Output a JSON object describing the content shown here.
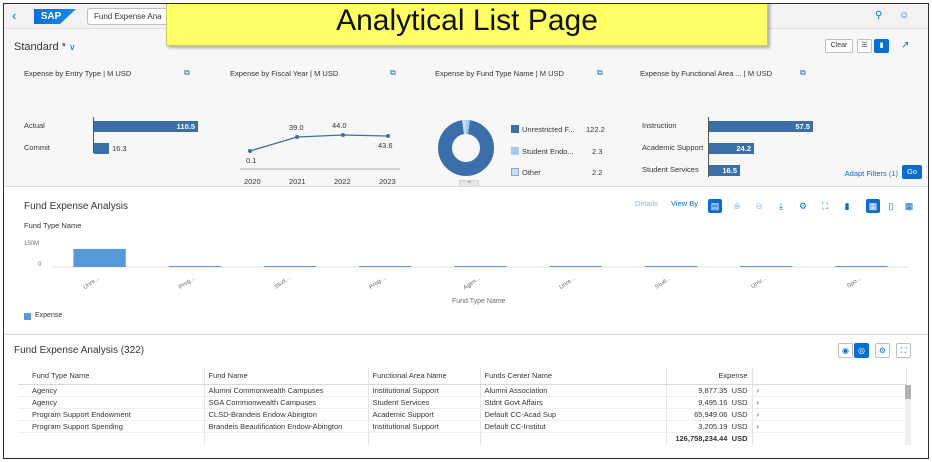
{
  "shell": {
    "app_title": "Fund Expense Ana",
    "logo": "SAP",
    "back_icon": "chevron-left-icon",
    "search_icon": "search-icon",
    "user_icon": "person-icon"
  },
  "banner": {
    "text": "Analytical List Page"
  },
  "header": {
    "variant": "Standard *",
    "clear_label": "Clear",
    "adapt_filters": "Adapt Filters (1)",
    "go_label": "Go",
    "collapse_icon": "chevron-up-icon"
  },
  "mini_charts": {
    "entry_type": {
      "title": "Expense by Entry Type  | M USD",
      "bars": [
        {
          "label": "Actual",
          "value": "110.5"
        },
        {
          "label": "Commit",
          "value": "16.3"
        }
      ]
    },
    "fiscal_year": {
      "title": "Expense by Fiscal Year  | M USD",
      "years": [
        "2020",
        "2021",
        "2022",
        "2023"
      ],
      "values": [
        "0.1",
        "39.0",
        "44.0",
        "43.6"
      ]
    },
    "fund_type": {
      "title": "Expense by Fund Type Name  | M USD",
      "legend": [
        {
          "label": "Unrestricted F...",
          "value": "122.2"
        },
        {
          "label": "Student Endo...",
          "value": "2.3"
        },
        {
          "label": "Other",
          "value": "2.2"
        }
      ]
    },
    "functional_area": {
      "title": "Expense by Functional Area ...  | M USD",
      "bars": [
        {
          "label": "Instruction",
          "value": "57.5"
        },
        {
          "label": "Academic Support",
          "value": "24.2"
        },
        {
          "label": "Student Services",
          "value": "16.5"
        }
      ]
    }
  },
  "chart_section": {
    "title": "Fund Expense Analysis",
    "subtitle": "Fund Type Name",
    "details": "Details",
    "view_by": "View By",
    "x_axis_title": "Fund Type Name",
    "legend": "Expense"
  },
  "chart_data": {
    "type": "bar",
    "categories": [
      "Unre...",
      "Prog...",
      "Stud...",
      "Prog...",
      "Agen...",
      "Unre...",
      "Stud...",
      "Univ...",
      "Spo..."
    ],
    "values": [
      118,
      2,
      2,
      2,
      1.5,
      1.5,
      1.2,
      1,
      1
    ],
    "ytick_labels": [
      "150M",
      "0"
    ],
    "ylim": [
      0,
      150
    ],
    "xlabel": "Fund Type Name",
    "ylabel": "",
    "series": [
      {
        "name": "Expense",
        "values": [
          118,
          2,
          2,
          2,
          1.5,
          1.5,
          1.2,
          1,
          1
        ]
      }
    ],
    "color": "#5899da"
  },
  "table": {
    "title": "Fund Expense Analysis (322)",
    "columns": [
      "Fund Type Name",
      "Fund Name",
      "Functional Area Name",
      "Funds Center Name",
      "Expense"
    ],
    "rows": [
      {
        "fund_type": "Agency",
        "fund_name": "Alumni Commonwealth Campuses",
        "functional_area": "Institutional Support",
        "funds_center": "Alumni Association",
        "expense": "9,877.35",
        "currency": "USD"
      },
      {
        "fund_type": "Agency",
        "fund_name": "SGA Commonwealth Campuses",
        "functional_area": "Student Services",
        "funds_center": "Stdnt Govt Affairs",
        "expense": "9,495.16",
        "currency": "USD"
      },
      {
        "fund_type": "Program Support Endowment",
        "fund_name": "CLSD-Brandeis Endow Abington",
        "functional_area": "Academic Support",
        "funds_center": "Default CC-Acad Sup",
        "expense": "65,949.06",
        "currency": "USD"
      },
      {
        "fund_type": "Program Support Spending",
        "fund_name": "Brandeis Beautification Endow-Abington",
        "functional_area": "Institutional Support",
        "funds_center": "Default CC-Institut",
        "expense": "3,205.19",
        "currency": "USD"
      }
    ],
    "total": {
      "expense": "126,758,234.44",
      "currency": "USD"
    }
  }
}
